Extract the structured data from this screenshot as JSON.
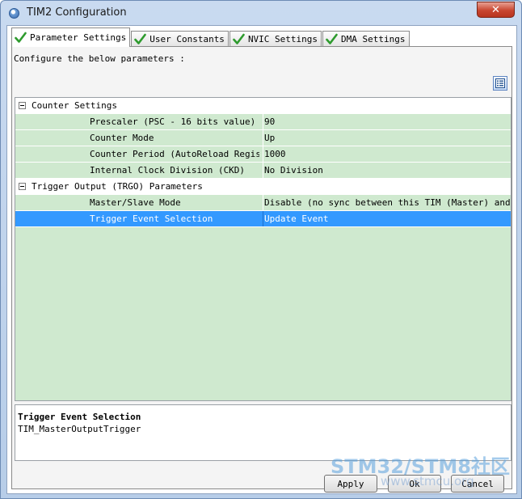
{
  "window": {
    "title": "TIM2 Configuration",
    "close_label": "✕"
  },
  "tabs": [
    {
      "label": "Parameter Settings",
      "active": true
    },
    {
      "label": "User Constants",
      "active": false
    },
    {
      "label": "NVIC Settings",
      "active": false
    },
    {
      "label": "DMA Settings",
      "active": false
    }
  ],
  "panel": {
    "instruction": "Configure the below parameters :"
  },
  "tree": {
    "groups": [
      {
        "label": "Counter Settings",
        "params": [
          {
            "name": "Prescaler (PSC - 16 bits value)",
            "value": "90"
          },
          {
            "name": "Counter Mode",
            "value": "Up"
          },
          {
            "name": "Counter Period (AutoReload Regis...",
            "value": "1000"
          },
          {
            "name": "Internal Clock Division (CKD)",
            "value": "No Division"
          }
        ]
      },
      {
        "label": "Trigger Output (TRGO) Parameters",
        "params": [
          {
            "name": "Master/Slave Mode",
            "value": "Disable (no sync between this TIM (Master) and ..."
          },
          {
            "name": "Trigger Event Selection",
            "value": "Update Event",
            "selected": true
          }
        ]
      }
    ]
  },
  "description": {
    "title": "Trigger Event Selection",
    "text": "TIM_MasterOutputTrigger"
  },
  "buttons": {
    "apply": "Apply",
    "ok": "Ok",
    "cancel": "Cancel"
  },
  "watermark": {
    "main": "STM32/STM8社区",
    "sub": "www.stmcu.org"
  },
  "colors": {
    "param_row_bg": "#cfe9cf",
    "selected_row_bg": "#3399ff",
    "check_green": "#2e9b2e"
  }
}
